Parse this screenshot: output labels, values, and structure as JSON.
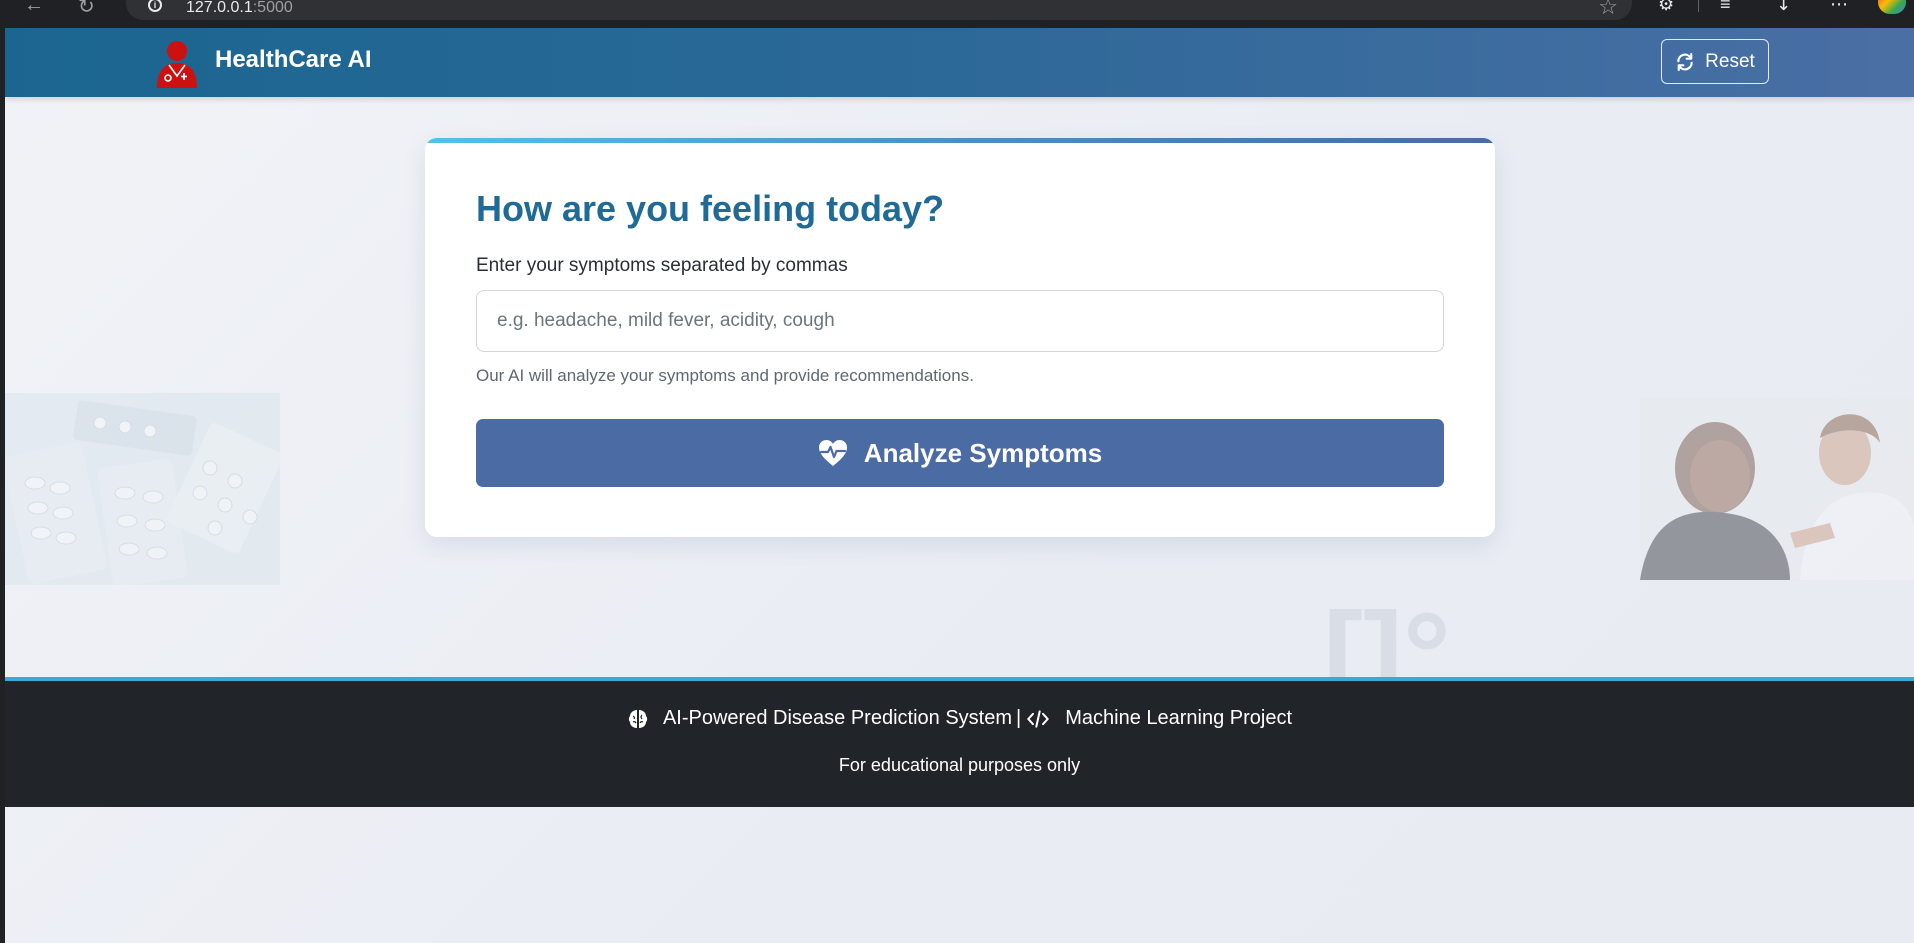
{
  "browser": {
    "url_host": "127.0.0.1",
    "url_port": ":5000"
  },
  "navbar": {
    "brand": "HealthCare AI",
    "reset_label": "Reset"
  },
  "form": {
    "title": "How are you feeling today?",
    "label": "Enter your symptoms separated by commas",
    "placeholder": "e.g. headache, mild fever, acidity, cough",
    "value": "",
    "helper": "Our AI will analyze your symptoms and provide recommendations.",
    "submit_label": "Analyze Symptoms"
  },
  "footer": {
    "system_label": "AI-Powered Disease Prediction System",
    "separator": "|",
    "project_label": "Machine Learning Project",
    "note": "For educational purposes only"
  },
  "colors": {
    "navbar_start": "#1b6691",
    "navbar_end": "#4a6fa5",
    "title": "#1f6a96",
    "submit_button": "#4a6ba3",
    "footer_bg": "#212529",
    "footer_accent": "#3aa8d8",
    "brand_icon": "#cc1111"
  },
  "icons": {
    "brand": "user-doctor-icon",
    "reset": "sync-icon",
    "submit": "heartbeat-icon",
    "footer_system": "brain-icon",
    "footer_project": "code-icon"
  }
}
